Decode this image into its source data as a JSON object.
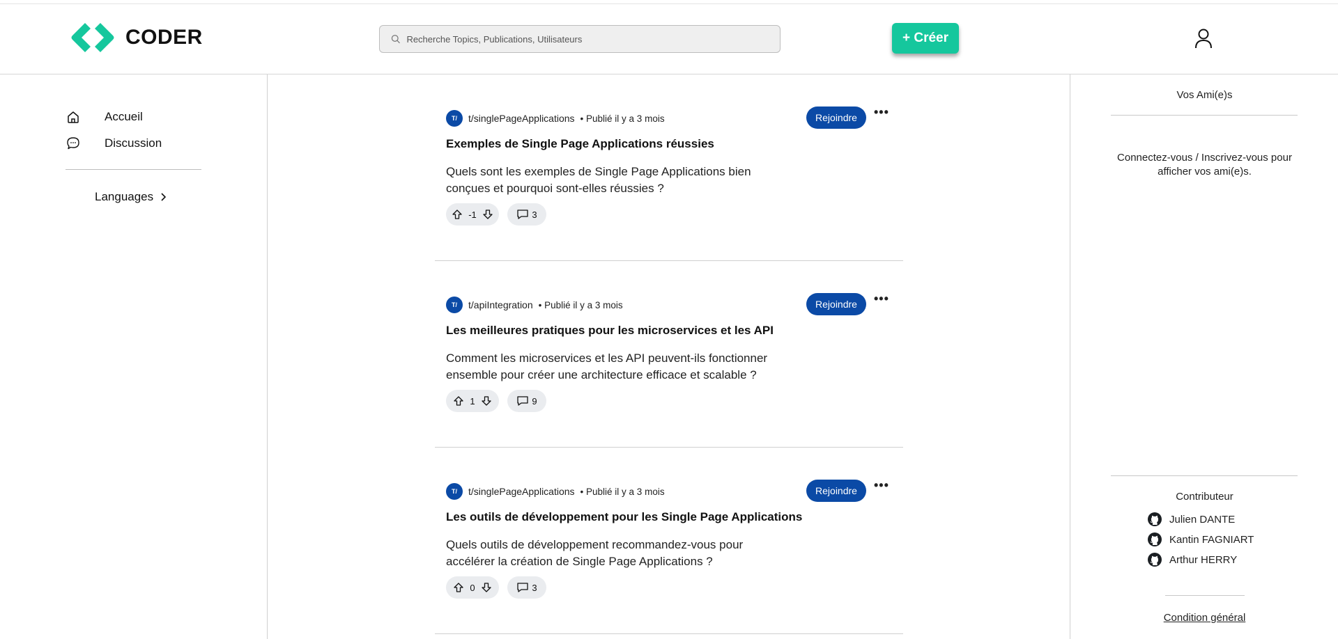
{
  "brand": {
    "name": "CODER",
    "accent": "#15c79d",
    "primary": "#0b4aa6"
  },
  "header": {
    "search_placeholder": "Recherche Topics, Publications, Utilisateurs",
    "create_label": "+ Créer"
  },
  "sidebar": {
    "items": [
      {
        "label": "Accueil",
        "icon": "home-icon"
      },
      {
        "label": "Discussion",
        "icon": "chat-icon"
      }
    ],
    "languages_label": "Languages"
  },
  "posts": [
    {
      "community": "t/singlePageApplications",
      "meta": "• Publié il y a 3 mois",
      "title": "Exemples de Single Page Applications réussies",
      "body": "Quels sont les exemples de Single Page Applications bien conçues et pourquoi sont-elles réussies ?",
      "votes": "-1",
      "comments": "3",
      "join_label": "Rejoindre",
      "avatar_text": "T/"
    },
    {
      "community": "t/apiIntegration",
      "meta": "• Publié il y a 3 mois",
      "title": "Les meilleures pratiques pour les microservices et les API",
      "body": "Comment les microservices et les API peuvent-ils fonctionner ensemble pour créer une architecture efficace et scalable ?",
      "votes": "1",
      "comments": "9",
      "join_label": "Rejoindre",
      "avatar_text": "T/"
    },
    {
      "community": "t/singlePageApplications",
      "meta": "• Publié il y a 3 mois",
      "title": "Les outils de développement pour les Single Page Applications",
      "body": "Quels outils de développement recommandez-vous pour accélérer la création de Single Page Applications ?",
      "votes": "0",
      "comments": "3",
      "join_label": "Rejoindre",
      "avatar_text": "T/"
    }
  ],
  "right": {
    "friends_title": "Vos Ami(e)s",
    "friends_message": "Connectez-vous / Inscrivez-vous pour afficher vos ami(e)s.",
    "contributors_title": "Contributeur",
    "contributors": [
      "Julien DANTE",
      "Kantin FAGNIART",
      "Arthur HERRY"
    ],
    "terms": "Condition général"
  }
}
